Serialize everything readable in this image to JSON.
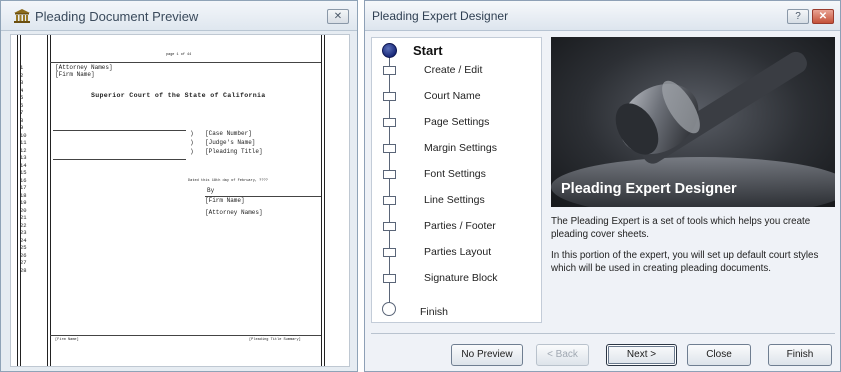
{
  "preview_window": {
    "title": "Pleading Document Preview",
    "close_glyph": "✕",
    "icon": "courthouse-icon",
    "page": {
      "page_indicator": "page 1 of 44",
      "line_numbers": [
        "1",
        "2",
        "3",
        "4",
        "5",
        "6",
        "7",
        "8",
        "9",
        "10",
        "11",
        "12",
        "13",
        "14",
        "15",
        "16",
        "17",
        "18",
        "19",
        "20",
        "21",
        "22",
        "23",
        "24",
        "25",
        "26",
        "27",
        "28"
      ],
      "attorney_names": "[Attorney Names]",
      "firm_name": "[Firm Name]",
      "court_title": "Superior Court of the State of California",
      "paren_1": ")",
      "paren_2": ")",
      "paren_3": ")",
      "case_number": "[Case Number]",
      "judge_name": "[Judge's Name]",
      "pleading_title": "[Pleading Title]",
      "dated": "Dated this 18th day of February, ????",
      "by": "By",
      "sig_firm_name": "[Firm Name]",
      "sig_attorney_names": "[Attorney Names]",
      "footer_left": "[Firm Name]",
      "footer_right": "[Pleading Title Summary]"
    }
  },
  "designer_window": {
    "title": "Pleading Expert Designer",
    "help_glyph": "?",
    "close_glyph": "✕",
    "steps": {
      "start": "Start",
      "items": [
        "Create / Edit",
        "Court Name",
        "Page Settings",
        "Margin Settings",
        "Font Settings",
        "Line Settings",
        "Parties / Footer",
        "Parties Layout",
        "Signature Block"
      ],
      "finish": "Finish"
    },
    "banner": {
      "title": "Pleading Expert Designer",
      "image": "gavel-image"
    },
    "description": {
      "para1": "The Pleading Expert is a set of tools which helps you create pleading cover sheets.",
      "para2": "In this portion of the expert, you will set up default court styles which will be used in creating pleading documents."
    },
    "buttons": {
      "no_preview": "No Preview",
      "back": "< Back",
      "next": "Next >",
      "close": "Close",
      "finish": "Finish"
    }
  }
}
